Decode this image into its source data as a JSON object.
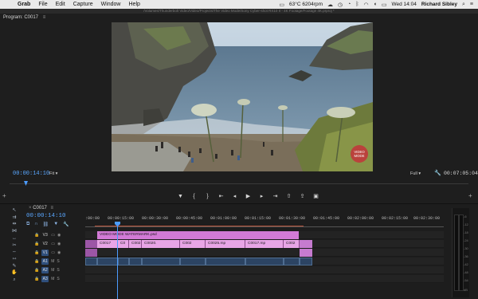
{
  "menubar": {
    "app": "Grab",
    "items": [
      "File",
      "Edit",
      "Capture",
      "Window",
      "Help"
    ],
    "temp": "63°C 6204rpm",
    "clock": "Wed 14:04",
    "user": "Richard Sibley"
  },
  "window_title": "/Volumes/Thunderbolt Video/Video/Projects/The Video Mode/Sony Cyber-shot RX10 II - 4K Footage/Footage 4K.prproj *",
  "program_monitor": {
    "title": "Program: C0017",
    "current_tc": "00:00:14:10",
    "fit_label": "Fit",
    "quality_label": "Full",
    "duration_tc": "00:07:05:04",
    "transport_icons": [
      "marker-icon",
      "in-point-icon",
      "out-point-icon",
      "go-to-in-icon",
      "step-back-icon",
      "play-icon",
      "step-forward-icon",
      "go-to-out-icon",
      "lift-icon",
      "extract-icon",
      "export-frame-icon"
    ],
    "watermark_text": "VIDEO MODE"
  },
  "timeline": {
    "sequence_name": "C0017",
    "current_tc": "00:00:14:10",
    "ruler_labels": [
      ":00:00",
      "00:00:15:00",
      "00:00:30:00",
      "00:00:45:00",
      "00:01:00:00",
      "00:01:15:00",
      "00:01:30:00",
      "00:01:45:00",
      "00:02:00:00",
      "00:02:15:00",
      "00:02:30:00"
    ],
    "tracks": [
      {
        "name": "V3",
        "selected": false
      },
      {
        "name": "V2",
        "selected": false
      },
      {
        "name": "V1",
        "selected": true
      },
      {
        "name": "A1",
        "selected": true
      },
      {
        "name": "A2",
        "selected": true
      },
      {
        "name": "A3",
        "selected": true
      }
    ],
    "v2_clip": "VIDEO MODE WATERMARK.psd",
    "v1_clips": [
      "C0017",
      "C0",
      "C002",
      "C0020.",
      "C002",
      "C0025.mp",
      "C0017.mp",
      "C002"
    ],
    "meter_labels": [
      "-6",
      "-12",
      "-18",
      "-24",
      "-30",
      "-36",
      "-42",
      "-48",
      "-54",
      "dB"
    ]
  }
}
